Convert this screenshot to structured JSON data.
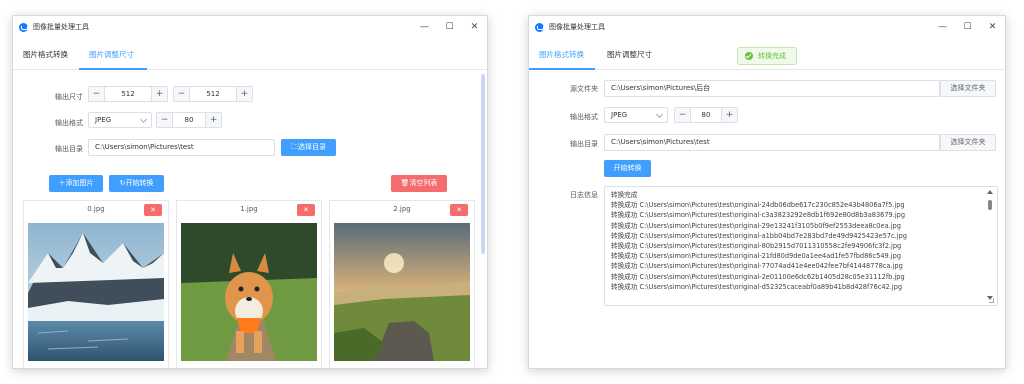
{
  "left_window": {
    "title": "图像批量处理工具",
    "controls": {
      "minimize": "—",
      "maximize": "☐",
      "close": "✕"
    },
    "tabs": [
      "图片格式转换",
      "图片调整尺寸"
    ],
    "active_tab": 1,
    "form": {
      "size_label": "输出尺寸",
      "width": "512",
      "height": "512",
      "format_label": "输出格式",
      "format_value": "JPEG",
      "quality": "80",
      "dir_label": "输出目录",
      "dir_value": "C:\\Users\\simon\\Pictures\\test",
      "choose_dir_button": "选择目录"
    },
    "actions": {
      "add_images": "添加图片",
      "start_convert": "开始转换",
      "clear_list": "清空列表"
    },
    "cards": [
      {
        "name": "0.jpg",
        "delete": "✕"
      },
      {
        "name": "1.jpg",
        "delete": "✕"
      },
      {
        "name": "2.jpg",
        "delete": "✕"
      }
    ]
  },
  "right_window": {
    "title": "图像批量处理工具",
    "controls": {
      "minimize": "—",
      "maximize": "☐",
      "close": "✕"
    },
    "tabs": [
      "图片格式转换",
      "图片调整尺寸"
    ],
    "active_tab": 0,
    "toast": "转换完成",
    "form": {
      "source_label": "源文件夹",
      "source_value": "C:\\Users\\simon\\Pictures\\后台",
      "choose_folder_1": "选择文件夹",
      "format_label": "输出格式",
      "format_value": "JPEG",
      "quality": "80",
      "dir_label": "输出目录",
      "dir_value": "C:\\Users\\simon\\Pictures\\test",
      "choose_folder_2": "选择文件夹",
      "start_button": "开始转换"
    },
    "log": {
      "label": "日志信息",
      "lines": [
        "转换完成",
        "转换成功 C:\\Users\\simon\\Pictures\\test\\original-24db06dbe617c230c852e43b4806a7f5.jpg",
        "转换成功 C:\\Users\\simon\\Pictures\\test\\original-c3a3823292e8db1f692e80d8b3a83679.jpg",
        "转换成功 C:\\Users\\simon\\Pictures\\test\\original-29e13241f3105b0f9ef2553deea8c0ea.jpg",
        "转换成功 C:\\Users\\simon\\Pictures\\test\\original-a1bb04bd7e283bd7de49d9425423e57c.jpg",
        "转换成功 C:\\Users\\simon\\Pictures\\test\\original-80b2915d7011310558c2fe94906fc3f2.jpg",
        "转换成功 C:\\Users\\simon\\Pictures\\test\\original-21fd80d9de0a1ee4ad1fe57fbd86c549.jpg",
        "转换成功 C:\\Users\\simon\\Pictures\\test\\original-77074ad41e4ee042fee7bf41448778ca.jpg",
        "转换成功 C:\\Users\\simon\\Pictures\\test\\original-2e01100e6dc62b1405d28c05e31112fb.jpg",
        "转换成功 C:\\Users\\simon\\Pictures\\test\\original-d52325caceabf0a89b41b8d428f76c42.jpg"
      ]
    }
  },
  "colors": {
    "primary": "#409eff",
    "danger": "#f56c6c",
    "success": "#67c23a"
  }
}
